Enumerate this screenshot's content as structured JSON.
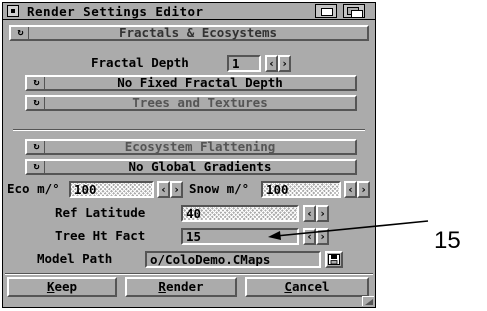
{
  "window": {
    "title": "Render Settings Editor"
  },
  "cycles": {
    "preset": "Fractals & Ecosystems",
    "fractal_mode": "No Fixed Fractal Depth",
    "textures": "Trees and Textures",
    "flattening": "Ecosystem Flattening",
    "gradients": "No Global Gradients"
  },
  "fields": {
    "fractal_depth": {
      "label": "Fractal Depth",
      "value": "1"
    },
    "eco_m": {
      "label": "Eco m/°",
      "value": "100"
    },
    "snow_m": {
      "label": "Snow m/°",
      "value": "100"
    },
    "ref_latitude": {
      "label": "Ref Latitude",
      "value": "40"
    },
    "tree_ht_fact": {
      "label": "Tree Ht Fact",
      "value": "15"
    },
    "model_path": {
      "label": "Model Path",
      "value": "o/ColoDemo.CMaps"
    }
  },
  "buttons": {
    "keep": {
      "key": "K",
      "rest": "eep"
    },
    "render": {
      "key": "R",
      "rest": "ender"
    },
    "cancel": {
      "key": "C",
      "rest": "ancel"
    }
  },
  "annotation": {
    "callout_text": "15"
  },
  "icons": {
    "cycle": "cycle-gadget-icon",
    "arrow_left": "‹",
    "arrow_right": "›"
  }
}
